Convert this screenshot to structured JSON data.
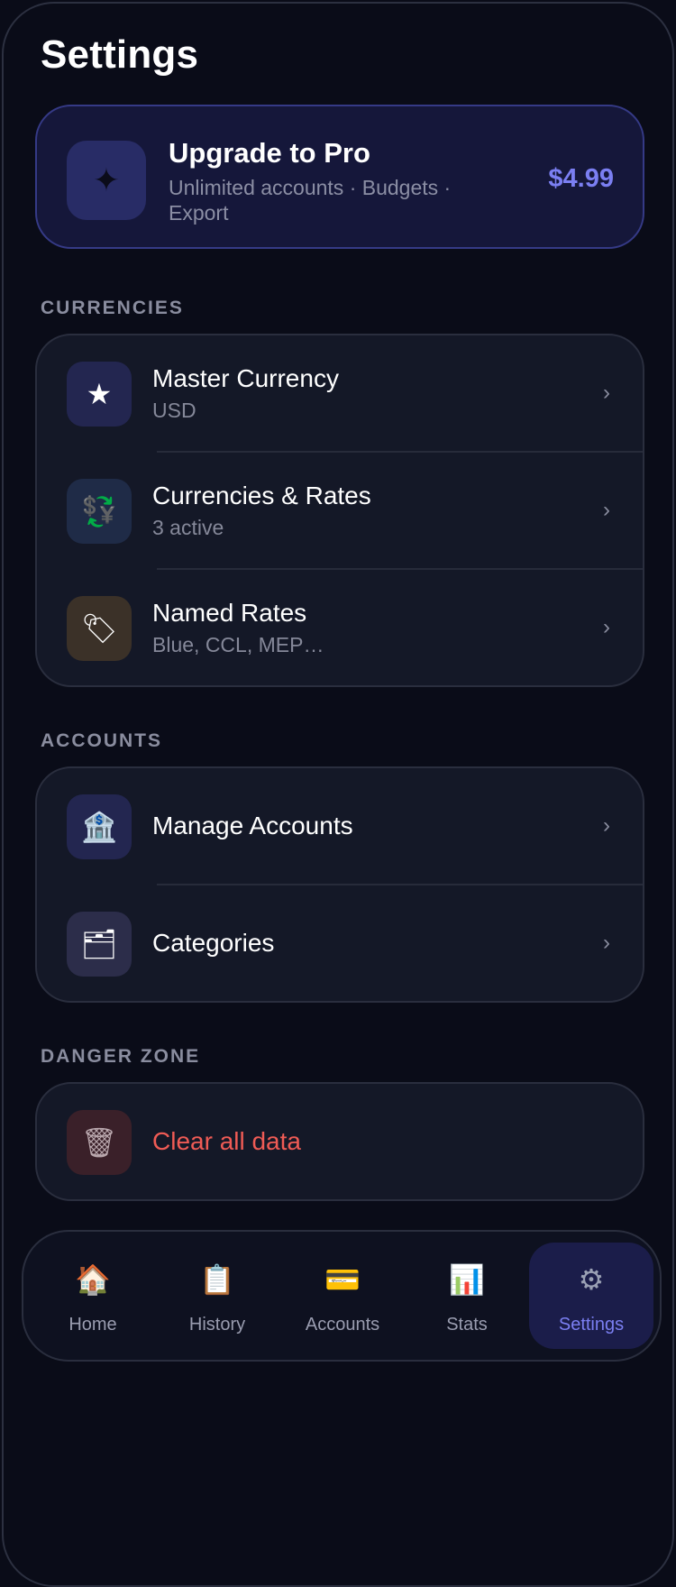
{
  "header": {
    "title": "Settings"
  },
  "promo": {
    "icon": "sparkle-icon",
    "glyph": "✦",
    "title": "Upgrade to Pro",
    "subtitle": "Unlimited accounts · Budgets · Export",
    "price": "$4.99"
  },
  "sections": {
    "currencies": {
      "label": "CURRENCIES",
      "items": [
        {
          "label": "Master Currency",
          "sub": "USD",
          "icon": "star-icon",
          "glyph": "★"
        },
        {
          "label": "Currencies & Rates",
          "sub": "3 active",
          "icon": "exchange-icon",
          "glyph": "💱"
        },
        {
          "label": "Named Rates",
          "sub": "Blue, CCL, MEP…",
          "icon": "tag-icon",
          "glyph": "🏷"
        }
      ]
    },
    "accounts": {
      "label": "ACCOUNTS",
      "items": [
        {
          "label": "Manage Accounts",
          "icon": "bank-icon",
          "glyph": "🏦"
        },
        {
          "label": "Categories",
          "icon": "card-index-icon",
          "glyph": "🗂"
        }
      ]
    },
    "danger": {
      "label": "DANGER ZONE",
      "items": [
        {
          "label": "Clear all data",
          "icon": "trash-icon",
          "glyph": "🗑"
        }
      ]
    }
  },
  "nav": {
    "items": [
      {
        "label": "Home",
        "icon": "house-icon",
        "glyph": "🏠"
      },
      {
        "label": "History",
        "icon": "clipboard-icon",
        "glyph": "📋"
      },
      {
        "label": "Accounts",
        "icon": "credit-card-icon",
        "glyph": "💳"
      },
      {
        "label": "Stats",
        "icon": "bar-chart-icon",
        "glyph": "📊"
      },
      {
        "label": "Settings",
        "icon": "gear-icon",
        "glyph": "⚙"
      }
    ],
    "active": "Settings"
  },
  "colors": {
    "background": "#0a0c18",
    "accent": "#7b7ff2",
    "danger": "#ef5b55",
    "card": "#141827"
  }
}
